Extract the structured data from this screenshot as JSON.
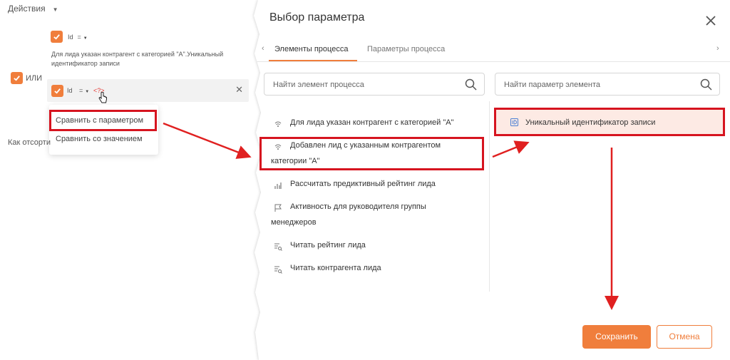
{
  "left_panel": {
    "actions_label": "Действия",
    "condition1": {
      "field": "Id",
      "operator": "="
    },
    "description": "Для лида указан контрагент с категорией \"А\".Уникальный идентификатор записи",
    "or_label": "ИЛИ",
    "condition2": {
      "field": "Id",
      "operator": "=",
      "value": "<?>"
    },
    "menu": [
      "Сравнить с параметром",
      "Сравнить со значением"
    ],
    "sort_label": "Как отсорти"
  },
  "dialog": {
    "title": "Выбор параметра",
    "tabs": [
      {
        "label": "Элементы процесса",
        "active": true
      },
      {
        "label": "Параметры процесса",
        "active": false
      }
    ],
    "element_search_placeholder": "Найти элемент процесса",
    "parameter_search_placeholder": "Найти параметр элемента",
    "elements": [
      {
        "icon": "signal-icon",
        "line1": "Для лида указан контрагент с категорией \"А\"",
        "line2": ""
      },
      {
        "icon": "signal-icon",
        "line1": "Добавлен лид с указанным контрагентом",
        "line2": "категории \"А\""
      },
      {
        "icon": "chart-icon",
        "line1": "Рассчитать предиктивный рейтинг лида",
        "line2": ""
      },
      {
        "icon": "flag-icon",
        "line1": "Активность для руководителя группы",
        "line2": "менеджеров"
      },
      {
        "icon": "read-data-icon",
        "line1": "Читать рейтинг лида",
        "line2": ""
      },
      {
        "icon": "read-data-icon",
        "line1": "Читать контрагента лида",
        "line2": ""
      }
    ],
    "selected_parameter": {
      "icon": "id-icon",
      "label": "Уникальный идентификатор записи"
    },
    "save_label": "Сохранить",
    "cancel_label": "Отмена"
  },
  "colors": {
    "accent": "#f07e3c",
    "highlight": "#d6141f",
    "selected_bg": "#fdeae4"
  }
}
